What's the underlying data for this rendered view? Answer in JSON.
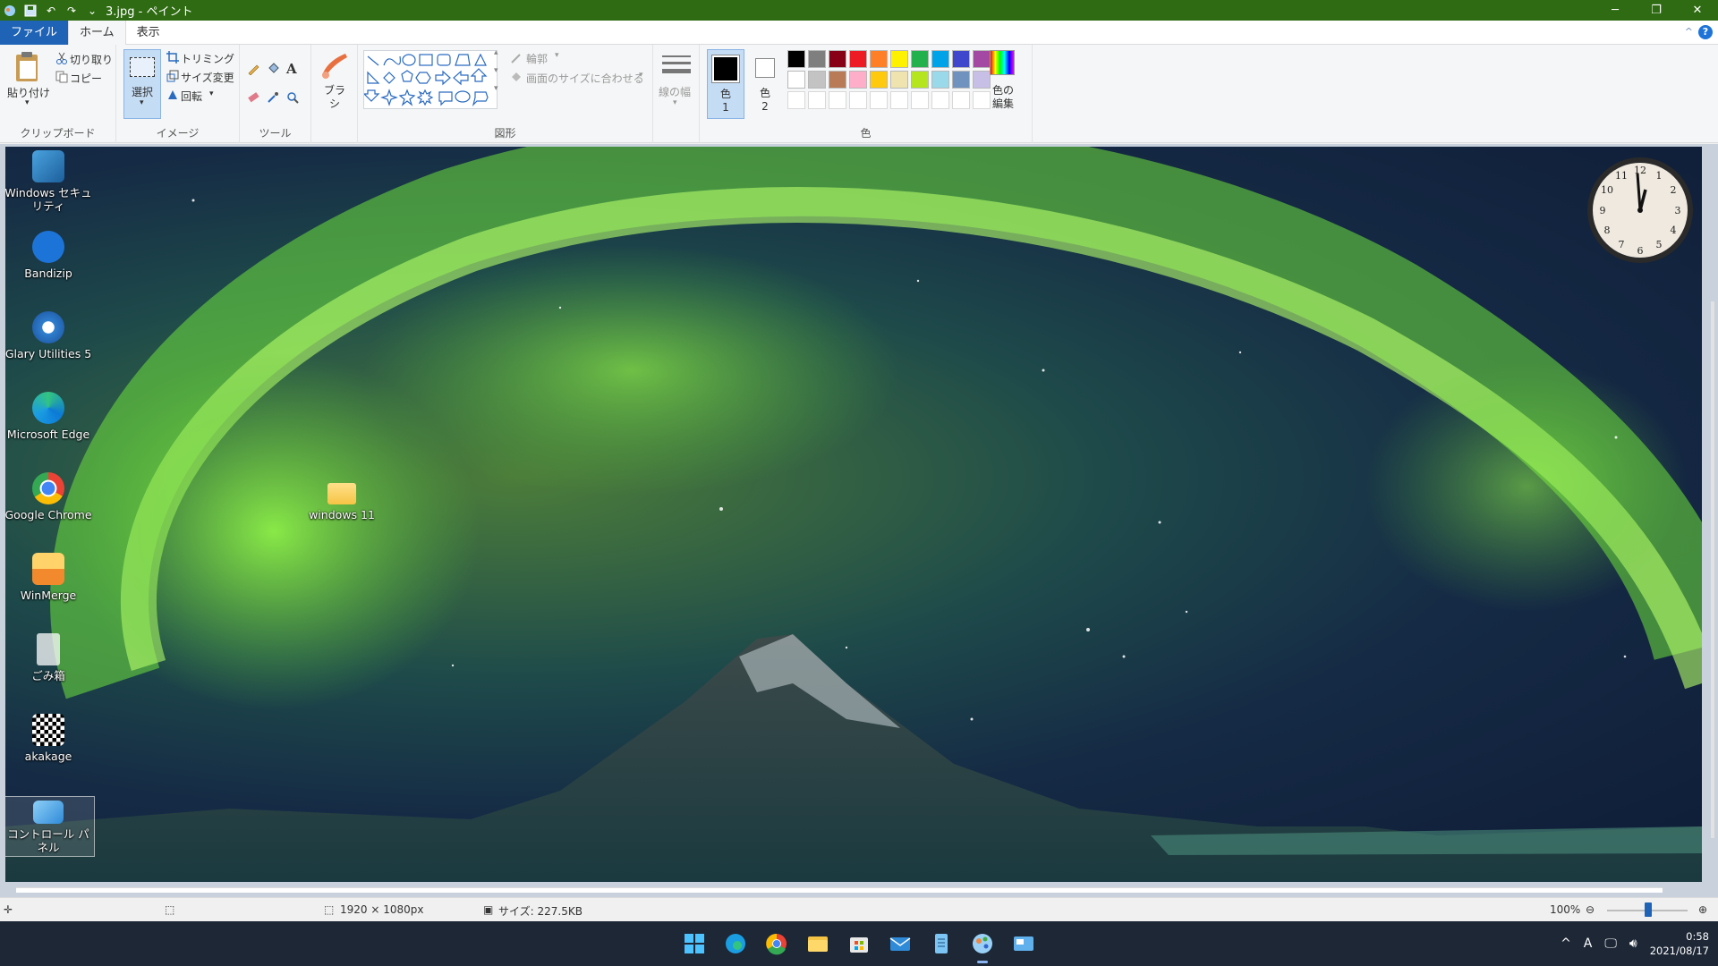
{
  "titlebar": {
    "title": "3.jpg - ペイント",
    "controls": [
      "minimize",
      "restore",
      "close"
    ]
  },
  "menu": {
    "tabs": [
      "ファイル",
      "ホーム",
      "表示"
    ]
  },
  "ribbon": {
    "clipboard": {
      "paste": "貼り付け",
      "cut": "切り取り",
      "copy": "コピー",
      "label": "クリップボード"
    },
    "image": {
      "select": "選択",
      "crop": "トリミング",
      "resize": "サイズ変更",
      "rotate": "回転",
      "label": "イメージ"
    },
    "tools": {
      "label": "ツール"
    },
    "brush": {
      "text": "ブラシ"
    },
    "shapes": {
      "outline": "輪郭",
      "fill": "画面のサイズに合わせる",
      "label": "図形"
    },
    "line_width": "線の幅",
    "color1": "色 1",
    "color2": "色 2",
    "edit_colors": "色の 編集",
    "colors_label": "色",
    "palette_row1": [
      "#000000",
      "#7f7f7f",
      "#880015",
      "#ed1c24",
      "#ff7f27",
      "#fff200",
      "#22b14c",
      "#00a2e8",
      "#3f48cc",
      "#a349a4"
    ],
    "palette_row2": [
      "#ffffff",
      "#c3c3c3",
      "#b97a57",
      "#ffaec9",
      "#ffc90e",
      "#efe4b0",
      "#b5e61d",
      "#99d9ea",
      "#7092be",
      "#c8bfe7"
    ]
  },
  "desktop": {
    "icons": [
      "Windows セキュリティ",
      "Bandizip",
      "Glary Utilities 5",
      "Microsoft Edge",
      "Google Chrome",
      "WinMerge",
      "ごみ箱",
      "akakage",
      "コントロール パネル"
    ],
    "folder": "windows 11"
  },
  "statusbar": {
    "dimensions": "1920 × 1080px",
    "size": "サイズ: 227.5KB",
    "zoom": "100%"
  },
  "taskbar": {
    "apps": [
      "start",
      "edge",
      "chrome",
      "explorer",
      "store",
      "mail",
      "notepad",
      "paint",
      "control-panel"
    ],
    "time": "0:58",
    "date": "2021/08/17",
    "ime": "A"
  }
}
